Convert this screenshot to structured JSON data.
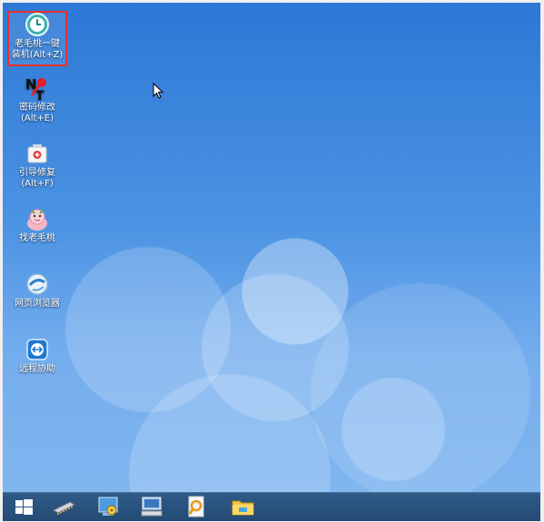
{
  "desktop": {
    "icons": [
      {
        "name": "lao-mao-tao-install-icon",
        "label_line1": "老毛桃一键",
        "label_line2": "装机(Alt+Z)",
        "selected": true
      },
      {
        "name": "password-edit-icon",
        "label_line1": "密码修改",
        "label_line2": "(Alt+E)"
      },
      {
        "name": "boot-repair-icon",
        "label_line1": "引导修复",
        "label_line2": "(Alt+F)"
      },
      {
        "name": "find-laomaotao-icon",
        "label_line1": "找老毛桃",
        "label_line2": ""
      },
      {
        "name": "web-browser-icon",
        "label_line1": "网页浏览器",
        "label_line2": ""
      },
      {
        "name": "remote-assist-icon",
        "label_line1": "远程协助",
        "label_line2": ""
      }
    ]
  },
  "taskbar": {
    "buttons": [
      "start-icon",
      "memory-chip-icon",
      "disk-image-icon",
      "computer-icon",
      "search-tool-icon",
      "folder-icon"
    ]
  },
  "colors": {
    "selection_border": "#e6312e",
    "taskbar": "#2a5480",
    "desktop_top": "#2d78d6",
    "desktop_bottom": "#7fb6ef"
  }
}
